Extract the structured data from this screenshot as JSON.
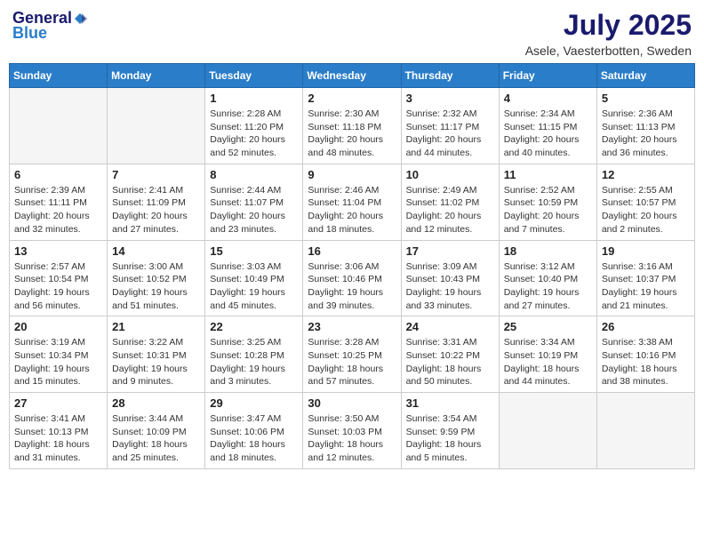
{
  "header": {
    "logo_general": "General",
    "logo_blue": "Blue",
    "title": "July 2025",
    "subtitle": "Asele, Vaesterbotten, Sweden"
  },
  "weekdays": [
    "Sunday",
    "Monday",
    "Tuesday",
    "Wednesday",
    "Thursday",
    "Friday",
    "Saturday"
  ],
  "weeks": [
    [
      {
        "num": "",
        "info": ""
      },
      {
        "num": "",
        "info": ""
      },
      {
        "num": "1",
        "info": "Sunrise: 2:28 AM\nSunset: 11:20 PM\nDaylight: 20 hours\nand 52 minutes."
      },
      {
        "num": "2",
        "info": "Sunrise: 2:30 AM\nSunset: 11:18 PM\nDaylight: 20 hours\nand 48 minutes."
      },
      {
        "num": "3",
        "info": "Sunrise: 2:32 AM\nSunset: 11:17 PM\nDaylight: 20 hours\nand 44 minutes."
      },
      {
        "num": "4",
        "info": "Sunrise: 2:34 AM\nSunset: 11:15 PM\nDaylight: 20 hours\nand 40 minutes."
      },
      {
        "num": "5",
        "info": "Sunrise: 2:36 AM\nSunset: 11:13 PM\nDaylight: 20 hours\nand 36 minutes."
      }
    ],
    [
      {
        "num": "6",
        "info": "Sunrise: 2:39 AM\nSunset: 11:11 PM\nDaylight: 20 hours\nand 32 minutes."
      },
      {
        "num": "7",
        "info": "Sunrise: 2:41 AM\nSunset: 11:09 PM\nDaylight: 20 hours\nand 27 minutes."
      },
      {
        "num": "8",
        "info": "Sunrise: 2:44 AM\nSunset: 11:07 PM\nDaylight: 20 hours\nand 23 minutes."
      },
      {
        "num": "9",
        "info": "Sunrise: 2:46 AM\nSunset: 11:04 PM\nDaylight: 20 hours\nand 18 minutes."
      },
      {
        "num": "10",
        "info": "Sunrise: 2:49 AM\nSunset: 11:02 PM\nDaylight: 20 hours\nand 12 minutes."
      },
      {
        "num": "11",
        "info": "Sunrise: 2:52 AM\nSunset: 10:59 PM\nDaylight: 20 hours\nand 7 minutes."
      },
      {
        "num": "12",
        "info": "Sunrise: 2:55 AM\nSunset: 10:57 PM\nDaylight: 20 hours\nand 2 minutes."
      }
    ],
    [
      {
        "num": "13",
        "info": "Sunrise: 2:57 AM\nSunset: 10:54 PM\nDaylight: 19 hours\nand 56 minutes."
      },
      {
        "num": "14",
        "info": "Sunrise: 3:00 AM\nSunset: 10:52 PM\nDaylight: 19 hours\nand 51 minutes."
      },
      {
        "num": "15",
        "info": "Sunrise: 3:03 AM\nSunset: 10:49 PM\nDaylight: 19 hours\nand 45 minutes."
      },
      {
        "num": "16",
        "info": "Sunrise: 3:06 AM\nSunset: 10:46 PM\nDaylight: 19 hours\nand 39 minutes."
      },
      {
        "num": "17",
        "info": "Sunrise: 3:09 AM\nSunset: 10:43 PM\nDaylight: 19 hours\nand 33 minutes."
      },
      {
        "num": "18",
        "info": "Sunrise: 3:12 AM\nSunset: 10:40 PM\nDaylight: 19 hours\nand 27 minutes."
      },
      {
        "num": "19",
        "info": "Sunrise: 3:16 AM\nSunset: 10:37 PM\nDaylight: 19 hours\nand 21 minutes."
      }
    ],
    [
      {
        "num": "20",
        "info": "Sunrise: 3:19 AM\nSunset: 10:34 PM\nDaylight: 19 hours\nand 15 minutes."
      },
      {
        "num": "21",
        "info": "Sunrise: 3:22 AM\nSunset: 10:31 PM\nDaylight: 19 hours\nand 9 minutes."
      },
      {
        "num": "22",
        "info": "Sunrise: 3:25 AM\nSunset: 10:28 PM\nDaylight: 19 hours\nand 3 minutes."
      },
      {
        "num": "23",
        "info": "Sunrise: 3:28 AM\nSunset: 10:25 PM\nDaylight: 18 hours\nand 57 minutes."
      },
      {
        "num": "24",
        "info": "Sunrise: 3:31 AM\nSunset: 10:22 PM\nDaylight: 18 hours\nand 50 minutes."
      },
      {
        "num": "25",
        "info": "Sunrise: 3:34 AM\nSunset: 10:19 PM\nDaylight: 18 hours\nand 44 minutes."
      },
      {
        "num": "26",
        "info": "Sunrise: 3:38 AM\nSunset: 10:16 PM\nDaylight: 18 hours\nand 38 minutes."
      }
    ],
    [
      {
        "num": "27",
        "info": "Sunrise: 3:41 AM\nSunset: 10:13 PM\nDaylight: 18 hours\nand 31 minutes."
      },
      {
        "num": "28",
        "info": "Sunrise: 3:44 AM\nSunset: 10:09 PM\nDaylight: 18 hours\nand 25 minutes."
      },
      {
        "num": "29",
        "info": "Sunrise: 3:47 AM\nSunset: 10:06 PM\nDaylight: 18 hours\nand 18 minutes."
      },
      {
        "num": "30",
        "info": "Sunrise: 3:50 AM\nSunset: 10:03 PM\nDaylight: 18 hours\nand 12 minutes."
      },
      {
        "num": "31",
        "info": "Sunrise: 3:54 AM\nSunset: 9:59 PM\nDaylight: 18 hours\nand 5 minutes."
      },
      {
        "num": "",
        "info": ""
      },
      {
        "num": "",
        "info": ""
      }
    ]
  ]
}
